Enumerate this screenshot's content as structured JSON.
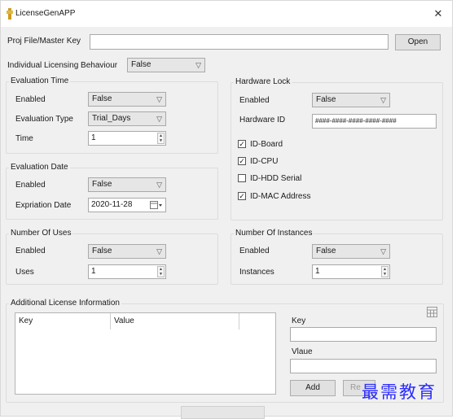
{
  "window": {
    "title": "LicenseGenAPP",
    "close_glyph": "✕",
    "icon": "app-icon"
  },
  "proj_file": {
    "label": "Proj File/Master Key",
    "value": "",
    "open_button": "Open"
  },
  "individual": {
    "label": "Individual Licensing Behaviour",
    "value": "False"
  },
  "evaluation_time": {
    "title": "Evaluation Time",
    "enabled_label": "Enabled",
    "enabled_value": "False",
    "type_label": "Evaluation Type",
    "type_value": "Trial_Days",
    "time_label": "Time",
    "time_value": "1"
  },
  "evaluation_date": {
    "title": "Evaluation Date",
    "enabled_label": "Enabled",
    "enabled_value": "False",
    "expiration_label": "Expriation Date",
    "expiration_value": "2020-11-28"
  },
  "number_of_uses": {
    "title": "Number Of Uses",
    "enabled_label": "Enabled",
    "enabled_value": "False",
    "uses_label": "Uses",
    "uses_value": "1"
  },
  "hardware_lock": {
    "title": "Hardware Lock",
    "enabled_label": "Enabled",
    "enabled_value": "False",
    "hwid_label": "Hardware ID",
    "hwid_value": "####-####-####-####-####",
    "checkboxes": [
      {
        "label": "ID-Board",
        "checked": true,
        "mark": "✓"
      },
      {
        "label": "ID-CPU",
        "checked": true,
        "mark": "✓"
      },
      {
        "label": "ID-HDD Serial",
        "checked": false,
        "mark": ""
      },
      {
        "label": "ID-MAC Address",
        "checked": true,
        "mark": "✓"
      }
    ]
  },
  "number_of_instances": {
    "title": "Number Of Instances",
    "enabled_label": "Enabled",
    "enabled_value": "False",
    "instances_label": "Instances",
    "instances_value": "1"
  },
  "additional": {
    "title": "Additional License Information",
    "columns": [
      "Key",
      "Value"
    ],
    "key_label": "Key",
    "key_value": "",
    "value_label": "Vlaue",
    "value_value": "",
    "add_button": "Add",
    "remove_button_partial": "Re"
  },
  "watermark": "最需教育",
  "icons": {
    "dropdown": "▽",
    "spin_up": "▲",
    "spin_down": "▼",
    "calendar": "calendar-icon"
  }
}
